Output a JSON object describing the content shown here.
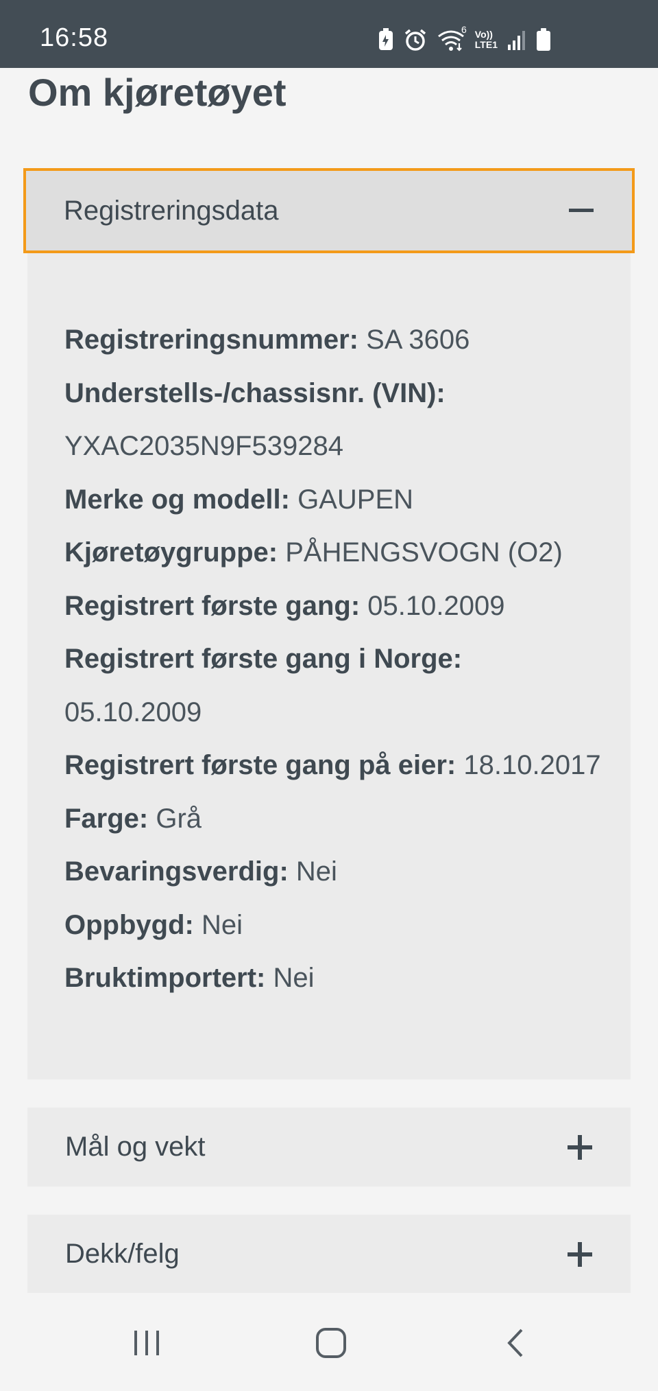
{
  "status_bar": {
    "time": "16:58",
    "icons": [
      "battery-saver-icon",
      "alarm-icon",
      "wifi-icon",
      "volte-lte-icon",
      "signal-icon",
      "battery-icon"
    ],
    "volte_text": "Vo))",
    "lte_text": "LTE1",
    "wifi_badge": "6"
  },
  "page": {
    "title": "Om kjøretøyet"
  },
  "accordion": {
    "open_section": {
      "label": "Registreringsdata",
      "toggle_icon": "minus-icon",
      "details": [
        {
          "key": "Registreringsnummer:",
          "value": "SA 3606"
        },
        {
          "key": "Understells-/chassisnr. (VIN):",
          "value": ""
        },
        {
          "key": "",
          "value": "YXAC2035N9F539284"
        },
        {
          "key": "Merke og modell:",
          "value": "GAUPEN"
        },
        {
          "key": "Kjøretøygruppe:",
          "value": "PÅHENGSVOGN (O2)"
        },
        {
          "key": "Registrert første gang:",
          "value": "05.10.2009"
        },
        {
          "key": "Registrert første gang i Norge:",
          "value": ""
        },
        {
          "key": "",
          "value": "05.10.2009"
        },
        {
          "key": "Registrert første gang på eier:",
          "value": "18.10.2017"
        },
        {
          "key": "Farge:",
          "value": "Grå"
        },
        {
          "key": "Bevaringsverdig:",
          "value": "Nei"
        },
        {
          "key": "Oppbygd:",
          "value": "Nei"
        },
        {
          "key": "Bruktimportert:",
          "value": "Nei"
        }
      ]
    },
    "collapsed_sections": [
      {
        "label": "Mål og vekt",
        "toggle_icon": "plus-icon"
      },
      {
        "label": "Dekk/felg",
        "toggle_icon": "plus-icon"
      }
    ]
  },
  "nav_bar": {
    "buttons": [
      "recent-apps-icon",
      "home-icon",
      "back-icon"
    ]
  },
  "colors": {
    "status_bar": "#434d55",
    "focus_outline": "#f39a19",
    "open_header_bg": "#dedede",
    "panel_bg": "#ebebeb",
    "page_bg": "#f4f4f4",
    "text": "#3f4951"
  }
}
